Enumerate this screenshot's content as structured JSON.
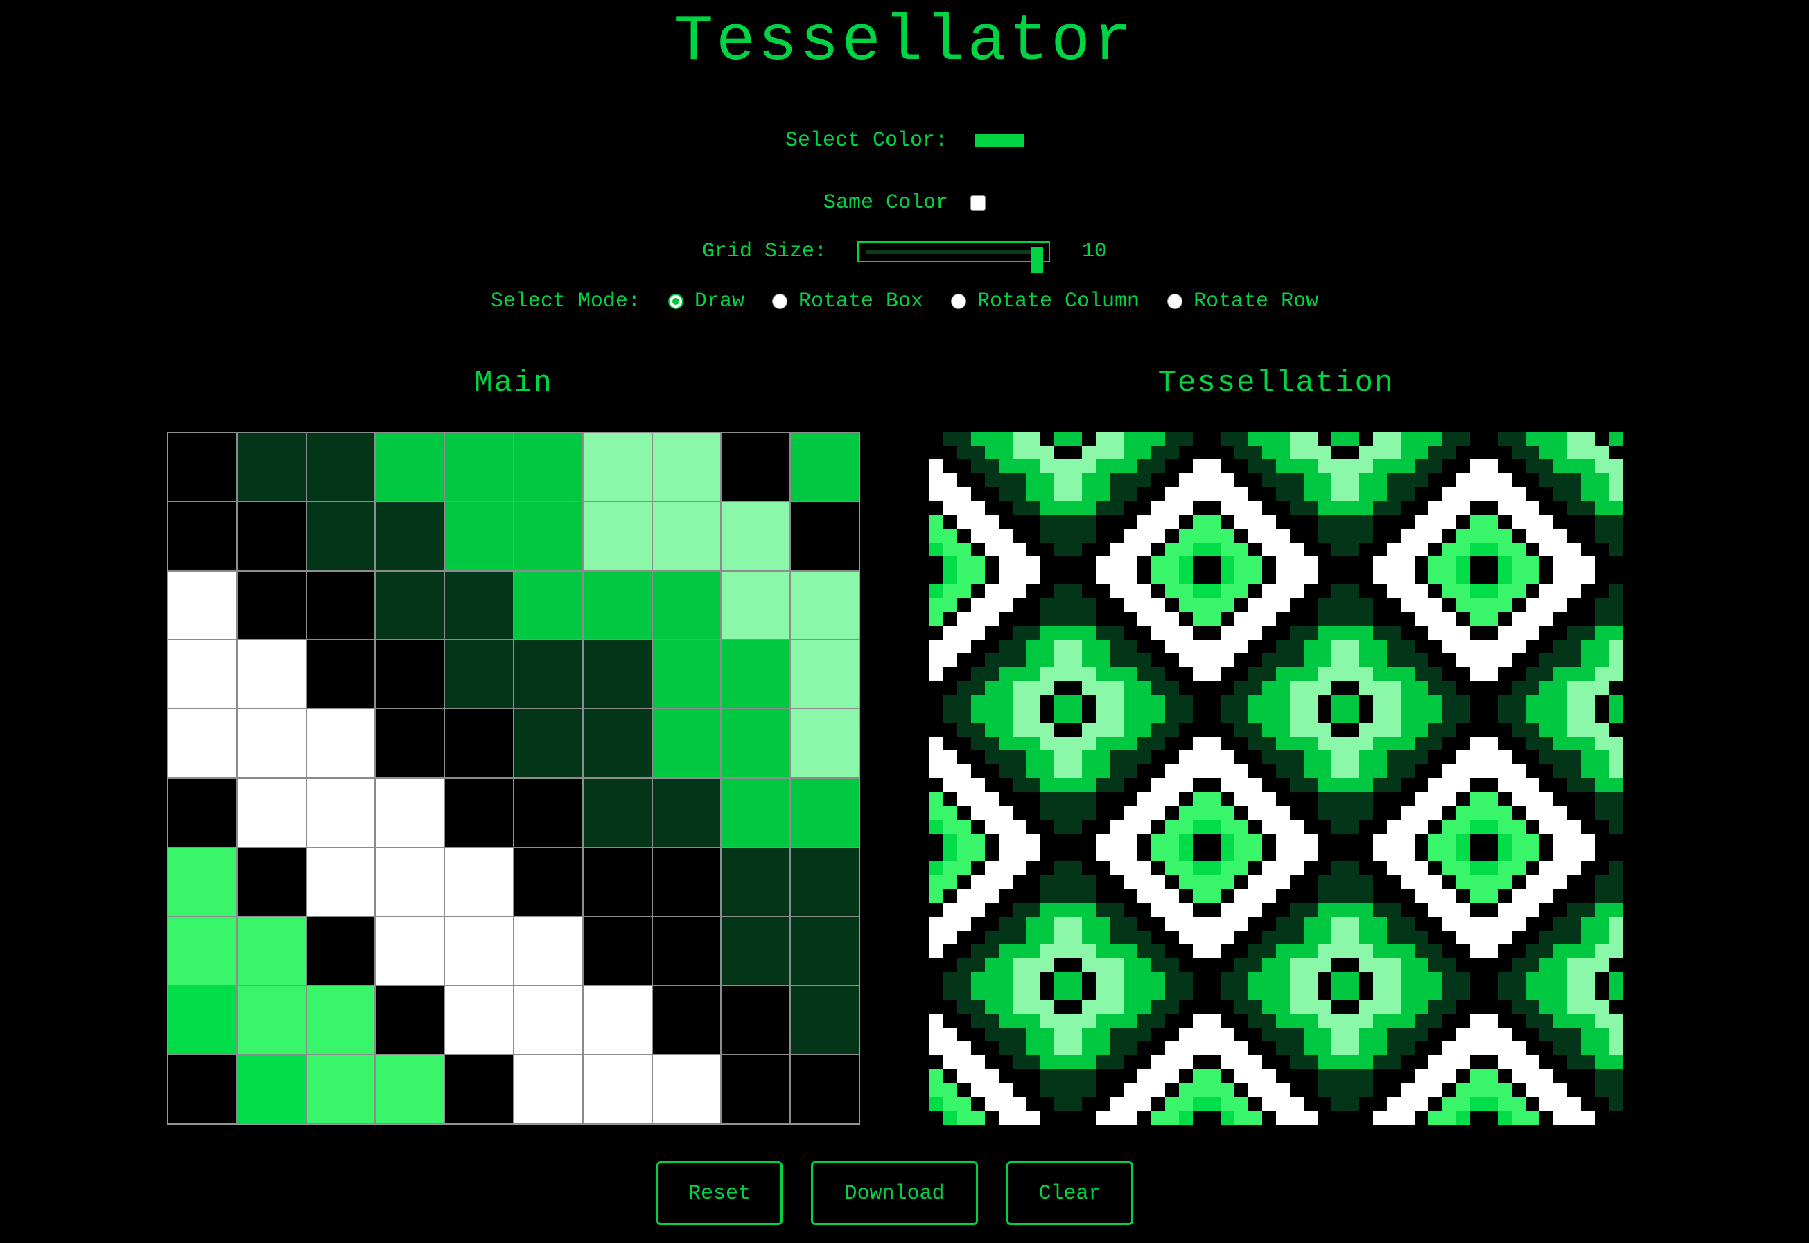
{
  "app": {
    "title": "Tessellator"
  },
  "controls": {
    "color_label": "Select Color:",
    "selected_color": "#00d443",
    "same_color_label": "Same Color",
    "same_color_checked": false,
    "grid_size_label": "Grid Size:",
    "grid_size_value": "10",
    "mode_label": "Select Mode:",
    "modes": [
      {
        "label": "Draw",
        "checked": true
      },
      {
        "label": "Rotate Box",
        "checked": false
      },
      {
        "label": "Rotate Column",
        "checked": false
      },
      {
        "label": "Rotate Row",
        "checked": false
      }
    ]
  },
  "panels": {
    "main_title": "Main",
    "tessellation_title": "Tessellation"
  },
  "palette": {
    "K": "#000000",
    "D": "#033519",
    "G": "#00c941",
    "L": "#8af8a8",
    "W": "#ffffff",
    "B": "#38f56a",
    "M": "#00dd48"
  },
  "grid": [
    "KDDGGGLLKG",
    "KKDDGGLLLK",
    "WKKDDGGGLL",
    "WWKKDDDGGL",
    "WWWKKDDGGL",
    "KWWWKKDDGG",
    "BKWWWKKKDD",
    "BBKWWWKKDD",
    "MBBKWWWKKD",
    "KMBBKWWWKK"
  ],
  "buttons": {
    "reset": "Reset",
    "download": "Download",
    "clear": "Clear"
  }
}
